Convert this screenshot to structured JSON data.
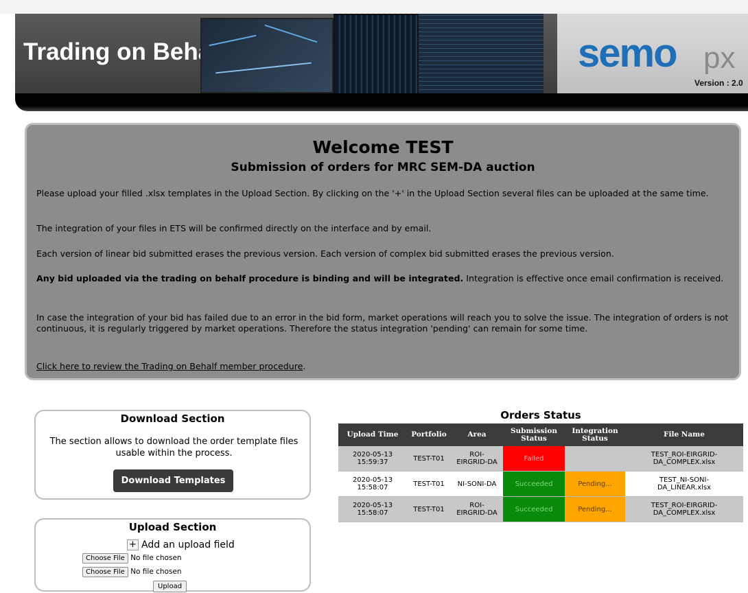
{
  "header": {
    "title": "Trading on Behalf",
    "logo_main": "semo",
    "logo_sub": "px",
    "version": "Version : 2.0"
  },
  "welcome": {
    "title": "Welcome TEST",
    "subtitle": "Submission of orders for MRC SEM-DA auction",
    "p1": "Please upload your filled .xlsx templates in the Upload Section. By clicking on the '+' in the Upload Section several files can be uploaded at the same time.",
    "p2": "The integration of your files in ETS will be confirmed directly on the interface and by email.",
    "p3": "Each version of linear bid submitted erases the previous version. Each version of complex bid submitted erases the previous version.",
    "p4_bold": "Any bid uploaded via the trading on behalf procedure is binding and will be integrated.",
    "p4_rest": " Integration is effective once email confirmation is received.",
    "p5": "In case the integration of your bid has failed due to an error in the bid form, market operations will reach you to solve the issue. The integration of orders is not continuous, it is regularly triggered by market operations. Therefore the status integration 'pending' can remain for some time.",
    "link": "Click here to review the Trading on Behalf member procedure",
    "link_suffix": "."
  },
  "download": {
    "title": "Download Section",
    "description": "The section allows to download the order template files usable within the process.",
    "button": "Download Templates"
  },
  "upload": {
    "title": "Upload Section",
    "plus": "+",
    "add_label": "Add an upload field",
    "choose_file": "Choose File",
    "no_file": "No file chosen",
    "button": "Upload"
  },
  "orders": {
    "title": "Orders Status",
    "headers": [
      "Upload Time",
      "Portfolio",
      "Area",
      "Submission Status",
      "Integration Status",
      "File Name"
    ],
    "rows": [
      {
        "time_date": "2020-05-13",
        "time_clock": "15:59:37",
        "portfolio": "TEST-T01",
        "area_1": "ROI-",
        "area_2": "EIRGRID-DA",
        "submission": "Failed",
        "integration": "",
        "file_1": "TEST_ROI-EIRGRID-",
        "file_2": "DA_COMPLEX.xlsx"
      },
      {
        "time_date": "2020-05-13",
        "time_clock": "15:58:07",
        "portfolio": "TEST-T01",
        "area_1": "NI-SONI-DA",
        "area_2": "",
        "submission": "Succeeded",
        "integration": "Pending...",
        "file_1": "TEST_NI-SONI-",
        "file_2": "DA_LINEAR.xlsx"
      },
      {
        "time_date": "2020-05-13",
        "time_clock": "15:58:07",
        "portfolio": "TEST-T01",
        "area_1": "ROI-",
        "area_2": "EIRGRID-DA",
        "submission": "Succeeded",
        "integration": "Pending...",
        "file_1": "TEST_ROI-EIRGRID-",
        "file_2": "DA_COMPLEX.xlsx"
      }
    ]
  },
  "colors": {
    "failed": "#ff0000",
    "succeeded": "#0a8a0a",
    "pending": "#ffa500",
    "header_bg": "#3b3b3b",
    "welcome_bg": "#8c8c8c",
    "logo_blue": "#1f6fb8"
  }
}
